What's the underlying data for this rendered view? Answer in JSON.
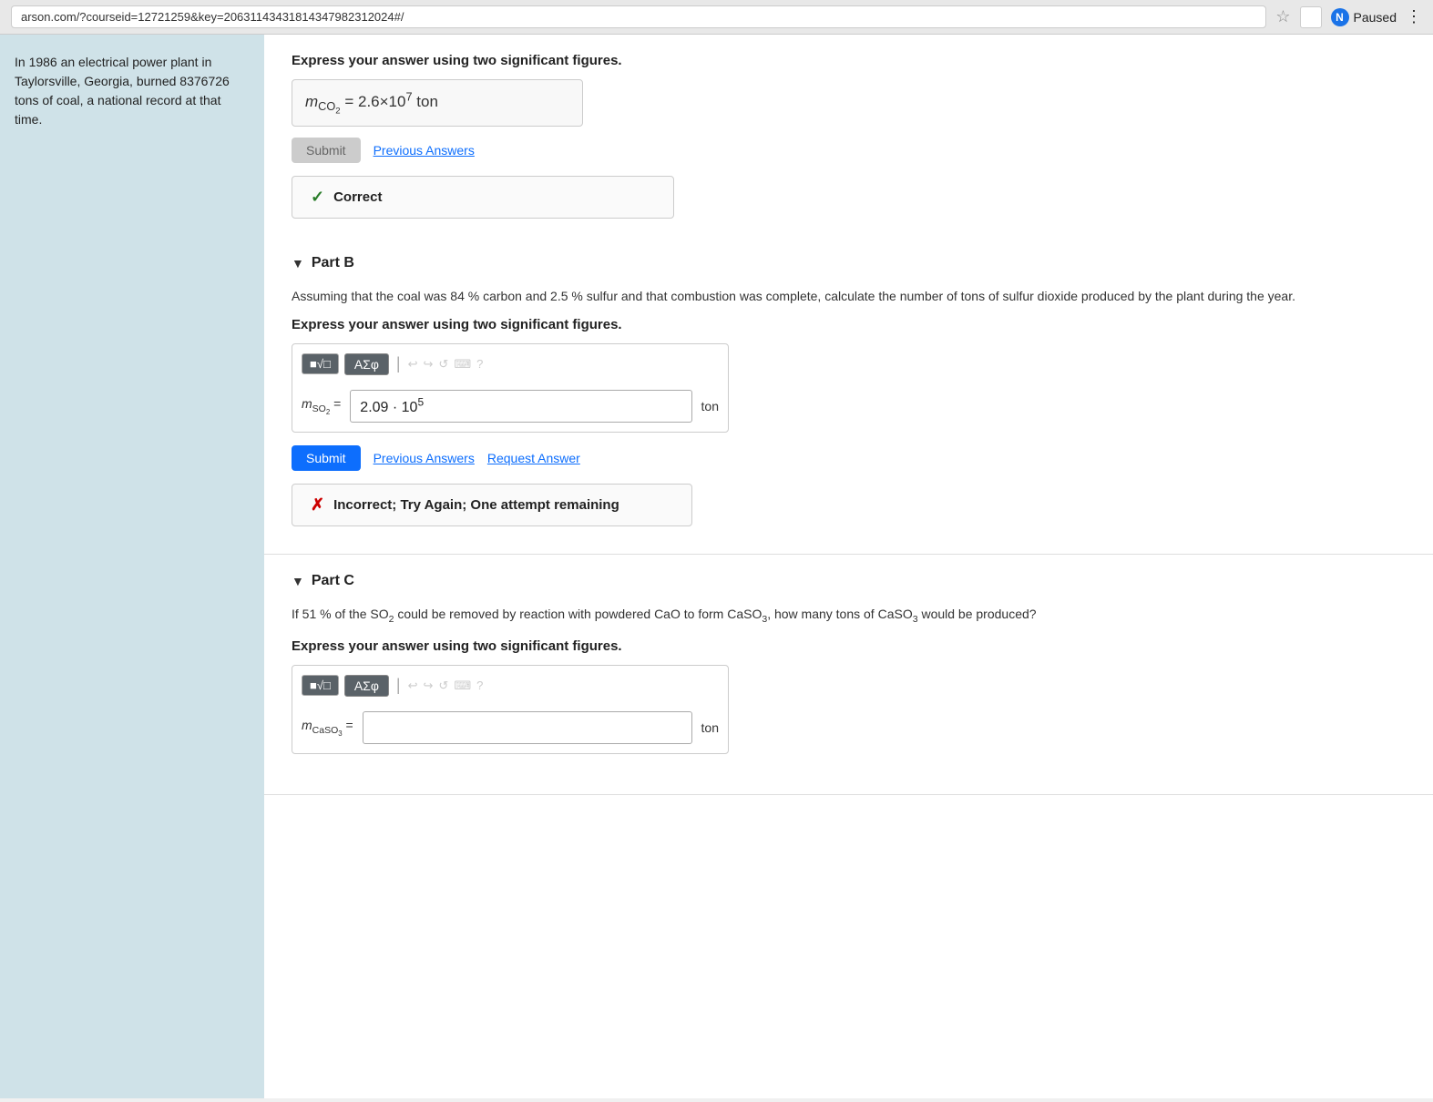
{
  "browser": {
    "url": "arson.com/?courseid=12721259&key=2063114343181434798231​2024#/",
    "pause_label": "Paused",
    "n_letter": "N"
  },
  "sidebar": {
    "text": "In 1986 an electrical power plant in Taylorsville, Georgia, burned 8376726 tons of coal, a national record at that time."
  },
  "top_answer": {
    "sig_figs_label": "Express your answer using two significant figures.",
    "answer_label": "m",
    "answer_subscript": "CO₂",
    "answer_equals": "=",
    "answer_value": "2.6×10",
    "answer_superscript": "7",
    "answer_unit": "ton",
    "submit_label": "Submit",
    "previous_answers_label": "Previous Answers",
    "correct_label": "Correct"
  },
  "part_b": {
    "part_label": "Part B",
    "question": "Assuming that the coal was 84 % carbon and 2.5 % sulfur and that combustion was complete, calculate the number of tons of sulfur dioxide produced by the plant during the year.",
    "sig_figs_label": "Express your answer using two significant figures.",
    "math_label": "m",
    "math_subscript": "SO₂",
    "math_value": "2.09 · 10⁵",
    "math_unit": "ton",
    "submit_label": "Submit",
    "previous_answers_label": "Previous Answers",
    "request_answer_label": "Request Answer",
    "incorrect_label": "Incorrect; Try Again; One attempt remaining",
    "toolbar": {
      "btn1": "■√□",
      "btn2": "ΑΣφ",
      "icon_undo": "↩",
      "icon_redo": "↪",
      "icon_refresh": "↺",
      "icon_keyboard": "⌨",
      "icon_help": "?"
    }
  },
  "part_c": {
    "part_label": "Part C",
    "question": "If 51 % of the SO₂ could be removed by reaction with powdered CaO to form CaSO₃, how many tons of CaSO₃ would be produced?",
    "sig_figs_label": "Express your answer using two significant figures.",
    "math_label": "m",
    "math_subscript": "CaSO₃",
    "math_unit": "ton",
    "toolbar": {
      "btn1": "■√□",
      "btn2": "ΑΣφ",
      "icon_undo": "↩",
      "icon_redo": "↪",
      "icon_refresh": "↺",
      "icon_keyboard": "⌨",
      "icon_help": "?"
    }
  }
}
